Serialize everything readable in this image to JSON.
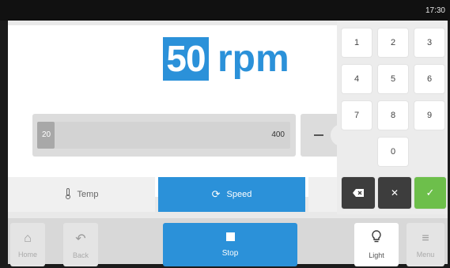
{
  "status": {
    "time": "17:30"
  },
  "display": {
    "value": "50",
    "unit": "rpm",
    "slider": {
      "min_label": "20",
      "max_label": "400",
      "fill_fraction": 0.0
    }
  },
  "tabs": [
    {
      "label": "Temp",
      "icon": "thermometer-icon"
    },
    {
      "label": "Speed",
      "icon": "refresh-icon"
    }
  ],
  "keypad": {
    "keys": [
      "1",
      "2",
      "3",
      "4",
      "5",
      "6",
      "7",
      "8",
      "9",
      "0"
    ],
    "backspace_icon": "backspace-icon",
    "clear_icon": "close-icon",
    "confirm_icon": "check-icon",
    "colors": {
      "confirm": "#6dbf4b",
      "dark": "#3d3d3d"
    }
  },
  "bottombar": {
    "home": "Home",
    "back": "Back",
    "stop": "Stop",
    "light": "Light",
    "menu": "Menu"
  },
  "colors": {
    "accent": "#2b91d9"
  }
}
